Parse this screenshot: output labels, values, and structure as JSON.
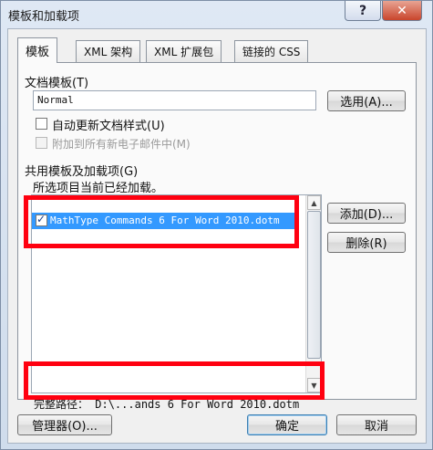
{
  "window": {
    "title": "模板和加载项",
    "help_label": "?",
    "close_label": "✕"
  },
  "tabs": [
    {
      "label": "模板"
    },
    {
      "label": "XML 架构"
    },
    {
      "label": "XML 扩展包"
    },
    {
      "label": "链接的 CSS"
    }
  ],
  "doc_template": {
    "group_label": "文档模板(T)",
    "value": "Normal",
    "select_button": "选用(A)...",
    "auto_update_label": "自动更新文档样式(U)",
    "attach_all_label": "附加到所有新电子邮件中(M)"
  },
  "global": {
    "group_label": "共用模板及加载项(G)",
    "hint": "所选项目当前已经加载。",
    "items": [
      {
        "text": "MathType Commands 6 For Word 2010.dotm",
        "checked": true
      }
    ],
    "add_button": "添加(D)...",
    "remove_button": "删除(R)",
    "full_path_label": "完整路径：",
    "full_path_value": "D:\\...ands 6 For Word 2010.dotm"
  },
  "footer": {
    "organizer_button": "管理器(O)...",
    "ok_button": "确定",
    "cancel_button": "取消"
  },
  "colors": {
    "highlight": "#ff0010",
    "selection": "#3399ff"
  }
}
